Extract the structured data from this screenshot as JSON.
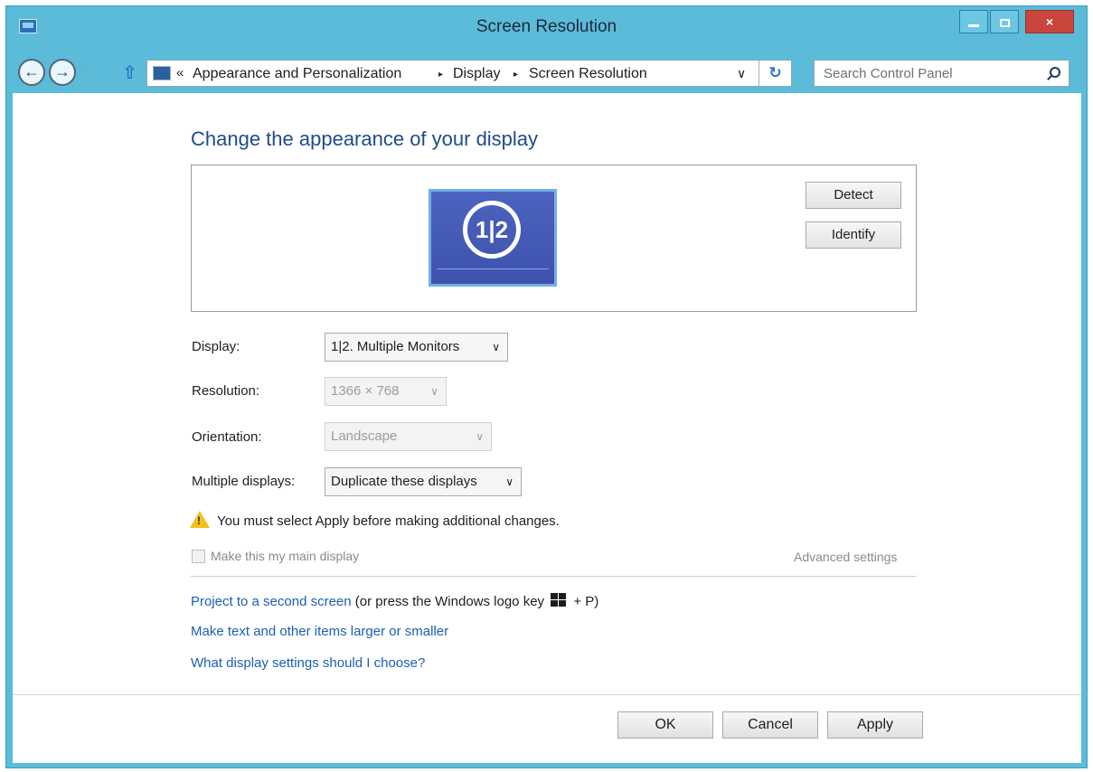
{
  "window": {
    "title": "Screen Resolution"
  },
  "titlebar": {
    "close_glyph": "×"
  },
  "nav": {
    "back_glyph": "←",
    "forward_glyph": "→",
    "breadcrumb_prefix": "«",
    "breadcrumb": [
      "Appearance and Personalization",
      "Display",
      "Screen Resolution"
    ],
    "separator": "▸",
    "dropdown_glyph": "∨",
    "refresh_glyph": "↻"
  },
  "search": {
    "placeholder": "Search Control Panel"
  },
  "main": {
    "heading": "Change the appearance of your display",
    "monitor_label": "1|2",
    "detect_label": "Detect",
    "identify_label": "Identify"
  },
  "settings": {
    "display_label": "Display:",
    "display_value": "1|2. Multiple Monitors",
    "resolution_label": "Resolution:",
    "resolution_value": "1366 × 768",
    "orientation_label": "Orientation:",
    "orientation_value": "Landscape",
    "multiple_label": "Multiple displays:",
    "multiple_value": "Duplicate these displays",
    "dropdown_arrow": "∨"
  },
  "warning": {
    "text": "You must select Apply before making additional changes."
  },
  "options": {
    "main_display_label": "Make this my main display",
    "advanced_settings": "Advanced settings"
  },
  "links": {
    "project_link": "Project to a second screen",
    "project_hint_before": " (or press the Windows logo key ",
    "project_hint_after": " + P)",
    "larger_text": "Make text and other items larger or smaller",
    "which_settings": "What display settings should I choose?"
  },
  "footer": {
    "ok": "OK",
    "cancel": "Cancel",
    "apply": "Apply"
  }
}
